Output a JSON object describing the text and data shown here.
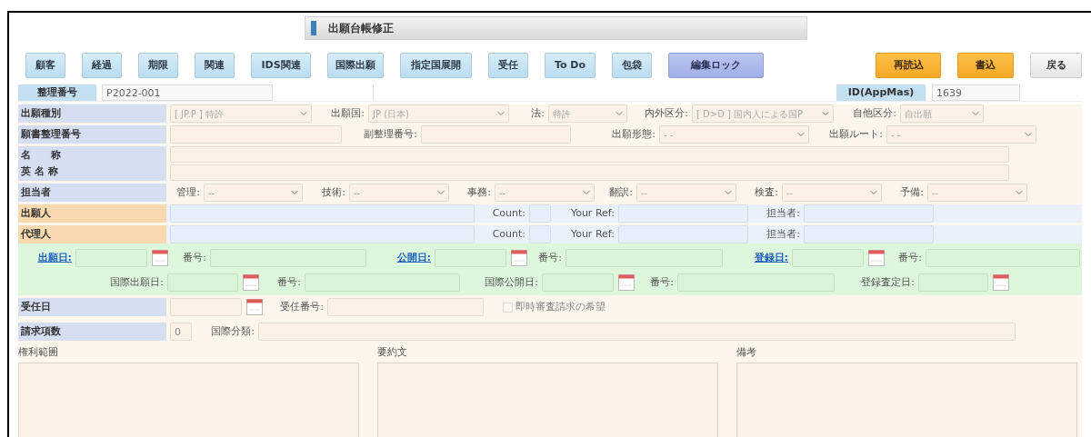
{
  "title": "出願台帳修正",
  "toolbar": [
    {
      "label": "顧客",
      "kind": "nav"
    },
    {
      "label": "経過",
      "kind": "nav"
    },
    {
      "label": "期限",
      "kind": "nav"
    },
    {
      "label": "関連",
      "kind": "nav"
    },
    {
      "label": "IDS関連",
      "kind": "nav"
    },
    {
      "label": "国際出願",
      "kind": "nav"
    },
    {
      "label": "指定国展開",
      "kind": "nav"
    },
    {
      "label": "受任",
      "kind": "nav"
    },
    {
      "label": "To Do",
      "kind": "nav"
    },
    {
      "label": "包袋",
      "kind": "nav"
    },
    {
      "label": "編集ロック",
      "kind": "lock"
    },
    {
      "label": "再読込",
      "kind": "action"
    },
    {
      "label": "書込",
      "kind": "action"
    },
    {
      "label": "戻る",
      "kind": "back"
    }
  ],
  "header": {
    "ref_label": "整理番号",
    "ref_value": "P2022-001",
    "id_label": "ID(AppMas)",
    "id_value": "1639"
  },
  "rows": [
    {
      "kind": "standard",
      "labels": [
        "出願種別"
      ],
      "color": "#d6dff2",
      "fields": [
        {
          "kind": "select",
          "value": "[ JP.P ] 特許"
        },
        {
          "kind": "select",
          "label": "出願国:",
          "value": "JP (日本)"
        },
        {
          "kind": "select",
          "label": "法:",
          "value": "特許"
        },
        {
          "kind": "select",
          "label": "内外区分:",
          "value": "[ D>D ] 国内人による国P"
        },
        {
          "kind": "select",
          "label": "自他区分:",
          "value": "自出願"
        }
      ]
    },
    {
      "kind": "standard",
      "labels": [
        "願書整理番号"
      ],
      "color": "#d6dff2",
      "fields": [
        {
          "kind": "input"
        },
        {
          "kind": "input",
          "label": "副整理番号:"
        },
        {
          "kind": "select",
          "label": "出願形態:",
          "value": "- -"
        },
        {
          "kind": "select",
          "label": "出願ルート:",
          "value": "- -"
        }
      ]
    },
    {
      "kind": "names",
      "labels": [
        "名　　称",
        "英 名 称"
      ],
      "color": "#d6dff2",
      "fields": [
        {
          "kind": "input"
        },
        {
          "kind": "input"
        }
      ]
    },
    {
      "kind": "standard",
      "labels": [
        "担当者"
      ],
      "color": "#d6dff2",
      "fields": [
        {
          "kind": "select",
          "label": "管理:",
          "value": "--"
        },
        {
          "kind": "select",
          "label": "技術:",
          "value": "--"
        },
        {
          "kind": "select",
          "label": "事務:",
          "value": "--"
        },
        {
          "kind": "select",
          "label": "翻訳:",
          "value": "--"
        },
        {
          "kind": "select",
          "label": "検査:",
          "value": "--"
        },
        {
          "kind": "select",
          "label": "予備:",
          "value": "--"
        }
      ]
    },
    {
      "kind": "party",
      "labels": [
        "出願人"
      ],
      "color": "#f8d9b0",
      "fields": [
        {
          "kind": "input"
        },
        {
          "kind": "input",
          "label": "Count:"
        },
        {
          "kind": "input",
          "label": "Your Ref:"
        },
        {
          "kind": "input",
          "label": "担当者:"
        }
      ]
    },
    {
      "kind": "party",
      "labels": [
        "代理人"
      ],
      "color": "#f8d9b0",
      "fields": [
        {
          "kind": "input"
        },
        {
          "kind": "input",
          "label": "Count:"
        },
        {
          "kind": "input",
          "label": "Your Ref:"
        },
        {
          "kind": "input",
          "label": "担当者:"
        }
      ]
    }
  ],
  "dates": [
    [
      {
        "label": "出願日:",
        "link": true,
        "kind": "date"
      },
      {
        "label": "番号:",
        "link": false,
        "kind": "input"
      },
      {
        "label": "公開日:",
        "link": true,
        "kind": "date"
      },
      {
        "label": "番号:",
        "link": false,
        "kind": "input"
      },
      {
        "label": "登録日:",
        "link": true,
        "kind": "date"
      },
      {
        "label": "番号:",
        "link": false,
        "kind": "input"
      }
    ],
    [
      {
        "label": "国際出願日:",
        "link": false,
        "kind": "date"
      },
      {
        "label": "番号:",
        "link": false,
        "kind": "input"
      },
      {
        "label": "国際公開日:",
        "link": false,
        "kind": "date"
      },
      {
        "label": "番号:",
        "link": false,
        "kind": "input"
      },
      {
        "label": "登録査定日:",
        "link": false,
        "kind": "date"
      }
    ]
  ],
  "lower_rows": [
    {
      "labels": [
        "受任日"
      ],
      "color": "#d6dff2",
      "fields": [
        {
          "kind": "date"
        },
        {
          "kind": "input",
          "label": "受任番号:"
        },
        {
          "kind": "checkbox",
          "label": "即時審査請求の希望",
          "checked": false
        }
      ]
    },
    {
      "labels": [
        "請求項数"
      ],
      "color": "#d6dff2",
      "fields": [
        {
          "kind": "input",
          "value": "0"
        },
        {
          "kind": "input",
          "label": "国際分類:"
        }
      ]
    }
  ],
  "notes": [
    {
      "label": "権利範囲"
    },
    {
      "label": "要約文"
    },
    {
      "label": "備考"
    }
  ]
}
